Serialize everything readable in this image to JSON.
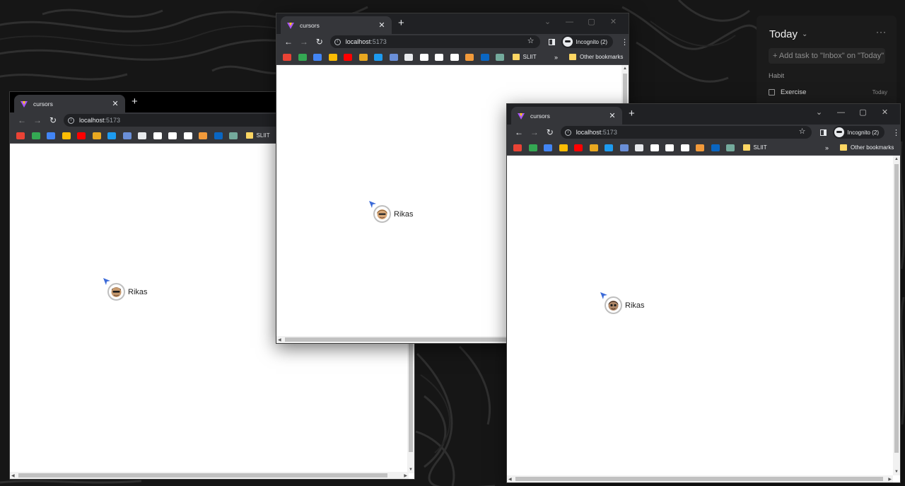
{
  "desktop": {
    "background": "#161616",
    "contour_color": "#2f2f2f"
  },
  "todo_widget": {
    "title": "Today",
    "add_task_placeholder": "+ Add task to \"Inbox\" on \"Today\"",
    "section": "Habit",
    "items": [
      {
        "label": "Exercise",
        "date": "Today"
      }
    ]
  },
  "windows": [
    {
      "tab_title": "cursors",
      "url_host": "localhost",
      "url_port": ":5173",
      "bookmark_folder": "SLIIT",
      "cursor": {
        "user": "Rikas",
        "pointer_color": "#3b6ad8"
      }
    },
    {
      "tab_title": "cursors",
      "url_host": "localhost",
      "url_port": ":5173",
      "profile_label": "Incognito (2)",
      "bookmark_folder": "SLIIT",
      "other_bookmarks": "Other bookmarks",
      "cursor": {
        "user": "Rikas",
        "pointer_color": "#3b6ad8"
      }
    },
    {
      "tab_title": "cursors",
      "url_host": "localhost",
      "url_port": ":5173",
      "profile_label": "Incognito (2)",
      "bookmark_folder": "SLIIT",
      "other_bookmarks": "Other bookmarks",
      "cursor": {
        "user": "Rikas",
        "pointer_color": "#3b6ad8"
      }
    }
  ],
  "icons": {
    "tab_favicon": "vite-logo-icon",
    "back": "back-arrow-icon",
    "forward": "forward-arrow-icon",
    "reload": "reload-icon",
    "site_info": "info-icon",
    "bookmark_star": "star-icon",
    "side_panel": "side-panel-icon",
    "incognito": "incognito-icon",
    "menu": "kebab-menu-icon",
    "bookmarks": [
      "gmail-icon",
      "drive-icon",
      "calendar-icon",
      "keep-icon",
      "youtube-icon",
      "slack-icon",
      "twitter-icon",
      "link-icon",
      "github-icon",
      "medium-icon",
      "dev-icon",
      "hashnode-icon",
      "blog-icon",
      "outlook-icon",
      "chatgpt-icon"
    ]
  },
  "bookmark_colors": [
    "#ea4335",
    "#34a853",
    "#4285f4",
    "#fbbc04",
    "#ff0000",
    "#e9a820",
    "#1d9bf0",
    "#6a8fd8",
    "#e8eaed",
    "#ffffff",
    "#ffffff",
    "#ffffff",
    "#f29a3a",
    "#0a66c2",
    "#74aa9c"
  ],
  "labels": {
    "i": "i",
    "new_tab": "+",
    "close": "✕",
    "star": "☆",
    "more": "»",
    "kebab": "⋮",
    "todo_more": "···",
    "chevron": "⌄",
    "win_min": "—",
    "win_max": "▢",
    "win_close": "✕",
    "win_chev": "⌄",
    "back": "←",
    "forward": "→",
    "reload": "↻"
  }
}
